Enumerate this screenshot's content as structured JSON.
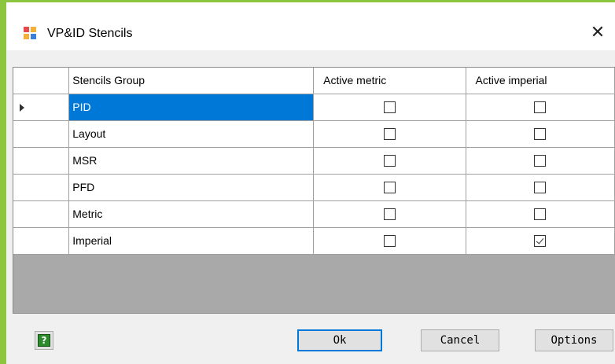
{
  "window": {
    "title": "VP&ID Stencils",
    "close_glyph": "✕"
  },
  "columns": [
    "Stencils Group",
    "Active metric",
    "Active imperial"
  ],
  "rows": [
    {
      "name": "PID",
      "metric": false,
      "imperial": false,
      "selected": true
    },
    {
      "name": "Layout",
      "metric": false,
      "imperial": false,
      "selected": false
    },
    {
      "name": "MSR",
      "metric": false,
      "imperial": false,
      "selected": false
    },
    {
      "name": "PFD",
      "metric": false,
      "imperial": false,
      "selected": false
    },
    {
      "name": "Metric",
      "metric": false,
      "imperial": false,
      "selected": false
    },
    {
      "name": "Imperial",
      "metric": false,
      "imperial": true,
      "selected": false
    }
  ],
  "buttons": {
    "ok": "Ok",
    "cancel": "Cancel",
    "options": "Options",
    "help_glyph": "?"
  },
  "colors": {
    "accent_frame": "#8cc63f",
    "selection": "#0078d7",
    "grid_background": "#a9a9a9"
  }
}
